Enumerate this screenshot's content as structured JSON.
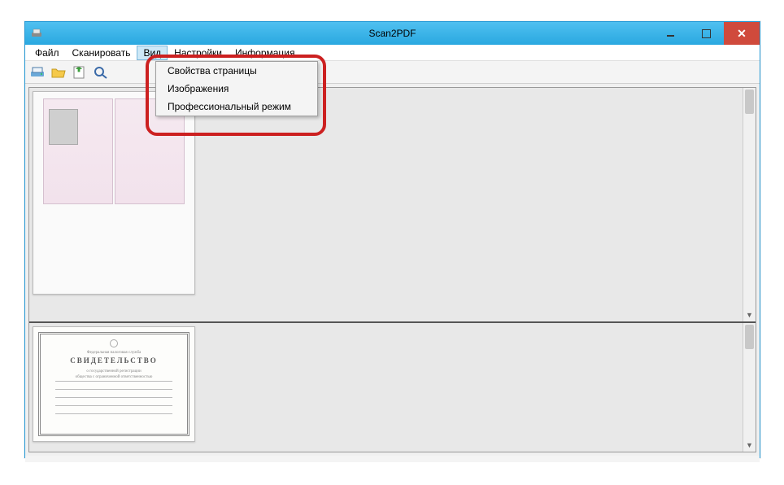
{
  "window": {
    "title": "Scan2PDF"
  },
  "menubar": {
    "items": [
      {
        "label": "Файл"
      },
      {
        "label": "Сканировать"
      },
      {
        "label": "Вид"
      },
      {
        "label": "Настройки"
      },
      {
        "label": "Информация"
      }
    ],
    "active_index": 2
  },
  "dropdown": {
    "items": [
      {
        "label": "Свойства страницы"
      },
      {
        "label": "Изображения"
      },
      {
        "label": "Профессиональный режим"
      }
    ]
  },
  "toolbar": {
    "icons": [
      "scanner-icon",
      "open-folder-icon",
      "save-icon",
      "zoom-icon"
    ]
  },
  "thumbnails": {
    "upper": {
      "kind": "passport-spread"
    },
    "lower": {
      "kind": "certificate",
      "smalltext_top": "Федеральная налоговая служба",
      "title": "СВИДЕТЕЛЬСТВО",
      "subtitle1": "о государственной регистрации",
      "subtitle2": "общества с ограниченной ответственностью"
    }
  }
}
